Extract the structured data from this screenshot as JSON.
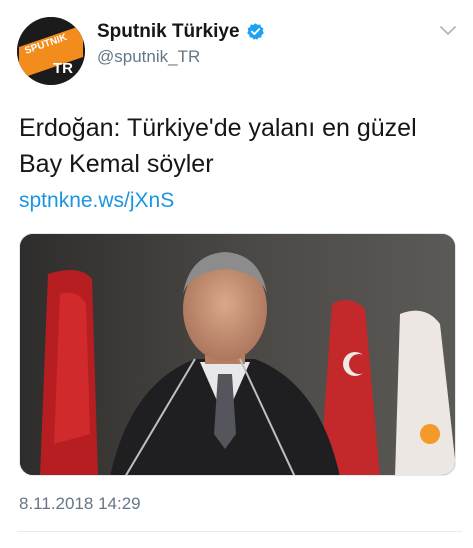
{
  "account": {
    "avatar_text_top": "SPUTNIK",
    "avatar_text_bottom": "TR",
    "display_name": "Sputnik Türkiye",
    "handle": "@sputnik_TR",
    "verified": true
  },
  "tweet": {
    "text": "Erdoğan: Türkiye'de yalanı en güzel Bay Kemal söyler",
    "link": "sptnkne.ws/jXnS",
    "timestamp": "8.11.2018 14:29"
  },
  "icons": {
    "verified": "verified-badge-icon",
    "caret": "chevron-down-icon"
  },
  "colors": {
    "brand_orange": "#f28c1c",
    "link_blue": "#1b95e0",
    "verified_blue": "#1da1f2",
    "muted_gray": "#657786"
  }
}
